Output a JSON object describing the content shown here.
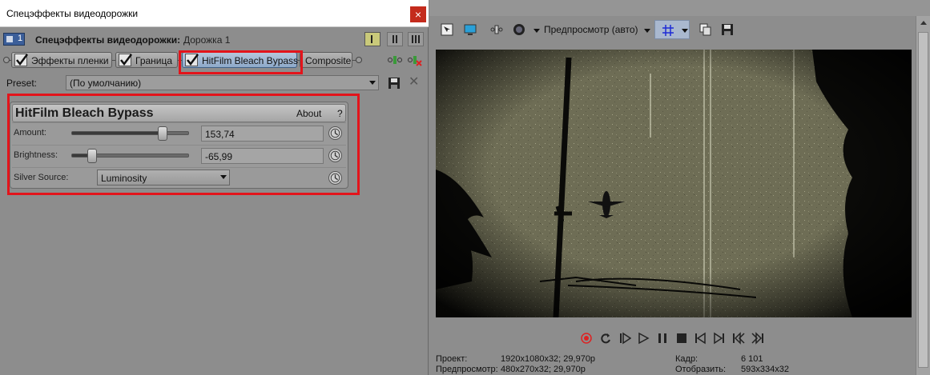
{
  "dialog": {
    "title": "Спецэффекты видеодорожки",
    "close_label": "×",
    "header_label": "Спецэффекты видеодорожки:",
    "track_name": "Дорожка 1",
    "track_number": "1"
  },
  "chain": {
    "plugins": [
      {
        "label": "Эффекты пленки",
        "checked": true
      },
      {
        "label": "Граница",
        "checked": true
      },
      {
        "label": "HitFilm Bleach Bypass",
        "checked": true,
        "selected": true
      },
      {
        "label": "Composite",
        "checked": false
      }
    ]
  },
  "preset": {
    "label": "Preset:",
    "value": "(По умолчанию)"
  },
  "effect_panel": {
    "title": "HitFilm Bleach Bypass",
    "about_label": "About",
    "help_label": "?",
    "params": [
      {
        "label": "Amount:",
        "value": "153,74",
        "slider_position": 0.78
      },
      {
        "label": "Brightness:",
        "value": "-65,99",
        "slider_position": 0.17
      }
    ],
    "silver_source": {
      "label": "Silver Source:",
      "value": "Luminosity"
    }
  },
  "preview": {
    "mode_label": "Предпросмотр (авто)"
  },
  "info": {
    "project_label": "Проект:",
    "project_value": "1920x1080x32; 29,970p",
    "preview_label": "Предпросмотр:",
    "preview_value": "480x270x32; 29,970p",
    "frame_label": "Кадр:",
    "frame_value": "6 101",
    "display_label": "Отобразить:",
    "display_value": "593x334x32"
  },
  "colors": {
    "highlight_red": "#e3141b",
    "selected_plugin": "#9fb6d4"
  }
}
